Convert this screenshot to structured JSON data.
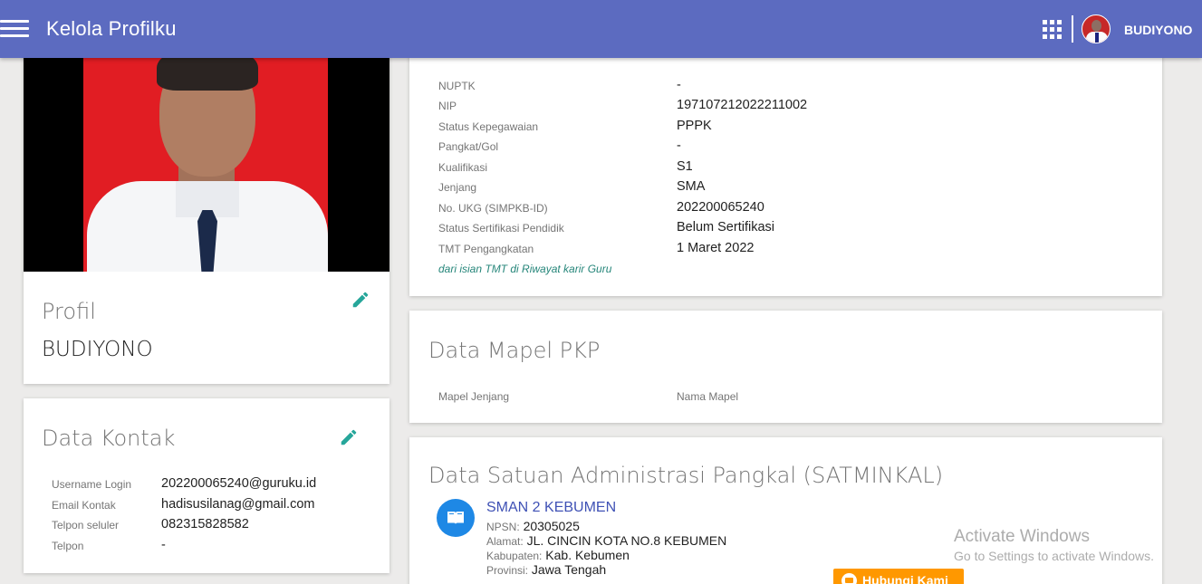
{
  "header": {
    "title": "Kelola Profilku",
    "username": "BUDIYONO"
  },
  "profile": {
    "section_title": "Profil",
    "name": "BUDIYONO"
  },
  "contact": {
    "section_title": "Data Kontak",
    "rows": [
      {
        "label": "Username Login",
        "value": "202200065240@guruku.id"
      },
      {
        "label": "Email Kontak",
        "value": "hadisusilanag@gmail.com"
      },
      {
        "label": "Telpon seluler",
        "value": "082315828582"
      },
      {
        "label": "Telpon",
        "value": "-"
      }
    ]
  },
  "employment": {
    "rows": [
      {
        "label": "NUPTK",
        "value": "-"
      },
      {
        "label": "NIP",
        "value": "197107212022211002"
      },
      {
        "label": "Status Kepegawaian",
        "value": "PPPK"
      },
      {
        "label": "Pangkat/Gol",
        "value": "-"
      },
      {
        "label": "Kualifikasi",
        "value": "S1"
      },
      {
        "label": "Jenjang",
        "value": "SMA"
      },
      {
        "label": "No. UKG (SIMPKB-ID)",
        "value": "202200065240"
      },
      {
        "label": "Status Sertifikasi Pendidik",
        "value": "Belum Sertifikasi"
      },
      {
        "label": "TMT Pengangkatan",
        "value": "1 Maret 2022"
      }
    ],
    "note": "dari isian TMT di Riwayat karir Guru"
  },
  "mapel": {
    "section_title": "Data Mapel PKP",
    "columns": [
      "Mapel Jenjang",
      "Nama Mapel"
    ]
  },
  "satminkal": {
    "section_title": "Data Satuan Administrasi Pangkal (SATMINKAL)",
    "school_name": "SMAN 2 KEBUMEN",
    "details": [
      {
        "label": "NPSN:",
        "value": "20305025"
      },
      {
        "label": "Alamat:",
        "value": "JL. CINCIN KOTA NO.8 KEBUMEN"
      },
      {
        "label": "Kabupaten:",
        "value": "Kab. Kebumen"
      },
      {
        "label": "Provinsi:",
        "value": "Jawa Tengah"
      }
    ]
  },
  "contact_button": {
    "label": "Hubungi Kami",
    "color": "#ff9800"
  },
  "watermark": {
    "line1": "Activate Windows",
    "line2": "Go to Settings to activate Windows."
  },
  "theme": {
    "topbar": "#5c6bc0",
    "accent": "#26867a"
  },
  "icons": {
    "menu": "hamburger-menu-icon",
    "apps": "apps-grid-icon",
    "edit": "pencil-edit-icon",
    "school": "book-icon"
  }
}
